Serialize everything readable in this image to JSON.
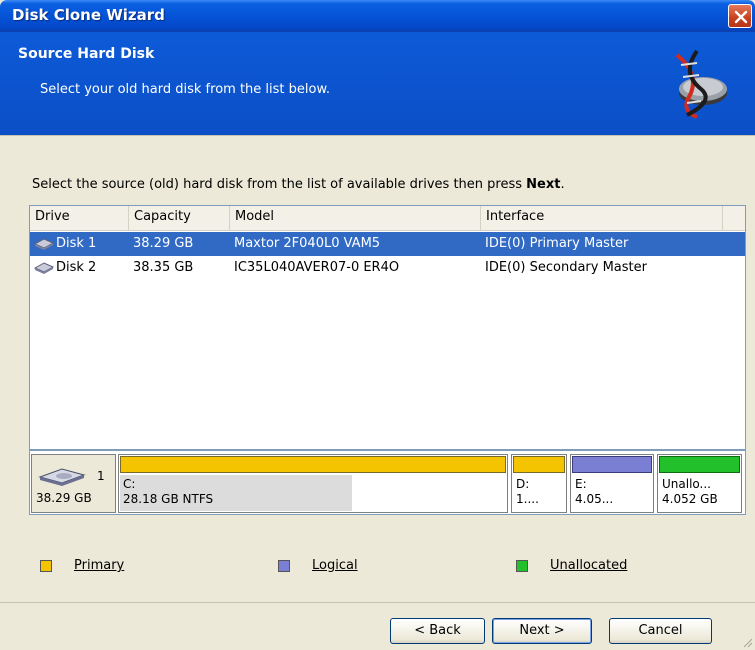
{
  "window": {
    "title": "Disk Clone Wizard",
    "close_icon": "close-icon"
  },
  "header": {
    "title": "Source Hard Disk",
    "subtitle": "Select your old hard disk from the list below.",
    "icon": "disk-clone-icon"
  },
  "instruction": {
    "text": "Select the source (old) hard disk from the list of available drives then press ",
    "emphasis": "Next",
    "end": "."
  },
  "table": {
    "columns": [
      "Drive",
      "Capacity",
      "Model",
      "Interface"
    ],
    "rows": [
      {
        "drive": "Disk 1",
        "capacity": "38.29 GB",
        "model": "Maxtor 2F040L0 VAM5",
        "interface": "IDE(0) Primary Master",
        "selected": true,
        "icon": "hard-disk-icon"
      },
      {
        "drive": "Disk 2",
        "capacity": "38.35 GB",
        "model": "IC35L040AVER07-0 ER4O",
        "interface": "IDE(0) Secondary Master",
        "selected": false,
        "icon": "hard-disk-icon"
      }
    ]
  },
  "diskmap": {
    "disk_number": "1",
    "disk_size": "38.29 GB",
    "partitions": [
      {
        "label": "C:",
        "detail": "28.18 GB  NTFS",
        "type": "primary",
        "used_fraction": 0.6
      },
      {
        "label": "D:",
        "detail": "1....",
        "type": "primary",
        "used_fraction": 0
      },
      {
        "label": "E:",
        "detail": "4.05...",
        "type": "logical",
        "used_fraction": 0
      },
      {
        "label": "Unallo...",
        "detail": "4.052 GB",
        "type": "unallocated",
        "used_fraction": 0
      }
    ]
  },
  "legend": {
    "primary": "Primary",
    "logical": "Logical",
    "unallocated": "Unallocated"
  },
  "colors": {
    "primary": "#f5c400",
    "logical": "#7b7fd4",
    "unallocated": "#22c02a",
    "selection": "#316ac5",
    "titlebar": "#0554d8"
  },
  "buttons": {
    "back": "< Back",
    "next": "Next >",
    "cancel": "Cancel"
  }
}
